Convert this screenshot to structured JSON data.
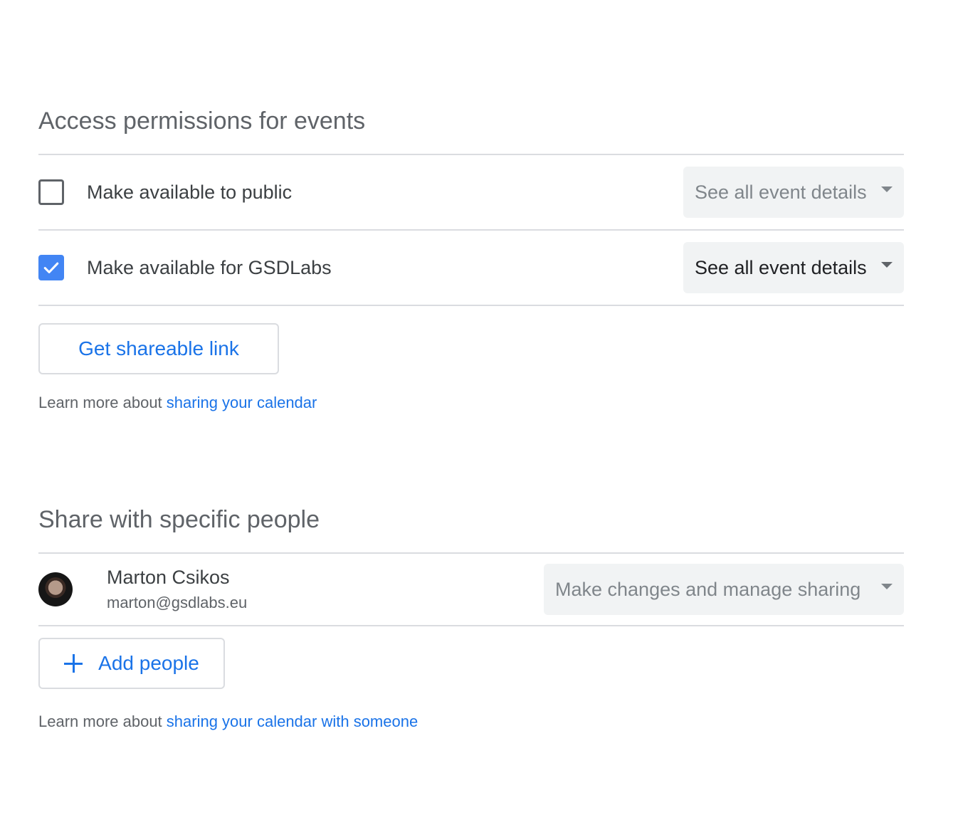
{
  "access": {
    "title": "Access permissions for events",
    "rows": [
      {
        "label": "Make available to public",
        "checked": false,
        "select_value": "See all event details"
      },
      {
        "label": "Make available for GSDLabs",
        "checked": true,
        "select_value": "See all event details"
      }
    ],
    "shareable_link_label": "Get shareable link",
    "learn_more_prefix": "Learn more about ",
    "learn_more_link": "sharing your calendar"
  },
  "share": {
    "title": "Share with specific people",
    "people": [
      {
        "name": "Marton Csikos",
        "email": "marton@gsdlabs.eu",
        "permission": "Make changes and manage sharing"
      }
    ],
    "add_people_label": "Add people",
    "learn_more_prefix": "Learn more about ",
    "learn_more_link": "sharing your calendar with someone"
  },
  "colors": {
    "accent": "#1a73e8",
    "checkbox_checked": "#4285f4",
    "divider": "#dadce0",
    "select_bg": "#f1f3f4"
  },
  "icons": {
    "checkbox_checked": "check-icon",
    "dropdown": "caret-down-icon",
    "add": "plus-icon"
  }
}
